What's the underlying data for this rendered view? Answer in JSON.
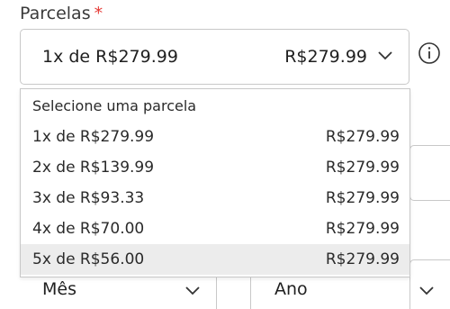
{
  "field": {
    "label": "Parcelas",
    "required_mark": "*",
    "selected_installment": "1x de R$279.99",
    "selected_total": "R$279.99"
  },
  "dropdown": {
    "header": "Selecione uma parcela",
    "options": [
      {
        "installment": "1x de R$279.99",
        "total": "R$279.99"
      },
      {
        "installment": "2x de R$139.99",
        "total": "R$279.99"
      },
      {
        "installment": "3x de R$93.33",
        "total": "R$279.99"
      },
      {
        "installment": "4x de R$70.00",
        "total": "R$279.99"
      },
      {
        "installment": "5x de R$56.00",
        "total": "R$279.99"
      }
    ],
    "highlighted_index": 4
  },
  "expiry": {
    "month_label": "Mês",
    "year_label": "Ano"
  },
  "icons": {
    "info": "info-icon",
    "chevron": "chevron-down-icon"
  },
  "colors": {
    "required": "#e53935",
    "border": "#c8c8c8",
    "highlight": "#ececec"
  }
}
